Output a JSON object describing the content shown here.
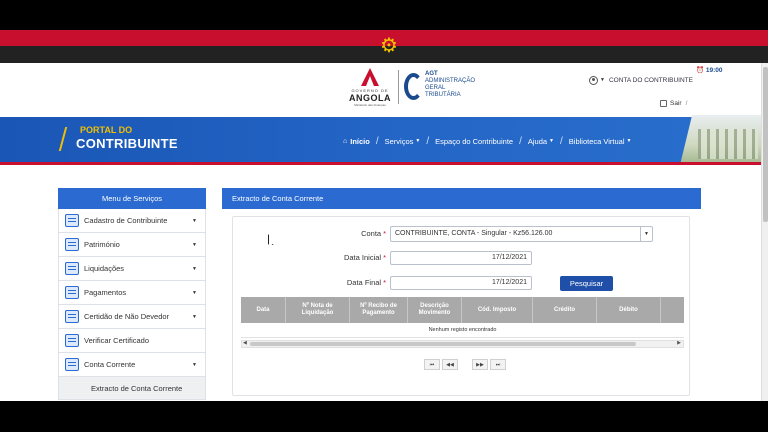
{
  "header": {
    "gov_logo": {
      "small": "GOVERNO DE",
      "big": "ANGOLA",
      "tiny": "Ministério das Finanças"
    },
    "agt_logo": {
      "abbr": "AGT",
      "line1": "ADMINISTRAÇÃO",
      "line2": "GERAL",
      "line3": "TRIBUTÁRIA"
    },
    "account_label": "CONTA DO CONTRIBUINTE",
    "time": "19:00",
    "logout_label": "Sair"
  },
  "banner": {
    "brand_line1": "PORTAL DO",
    "brand_line2": "CONTRIBUINTE",
    "nav": [
      {
        "label": "Início",
        "icon": "home-icon",
        "dropdown": false
      },
      {
        "label": "Serviços",
        "dropdown": true
      },
      {
        "label": "Espaço do Contribuinte",
        "dropdown": false
      },
      {
        "label": "Ajuda",
        "dropdown": true
      },
      {
        "label": "Biblioteca Virtual",
        "dropdown": true
      }
    ]
  },
  "sidebar": {
    "title": "Menu de Serviços",
    "items": [
      {
        "label": "Cadastro de Contribuinte",
        "icon": "registry-icon",
        "dropdown": true
      },
      {
        "label": "Património",
        "icon": "building-icon",
        "dropdown": true
      },
      {
        "label": "Liquidações",
        "icon": "document-icon",
        "dropdown": true
      },
      {
        "label": "Pagamentos",
        "icon": "payment-icon",
        "dropdown": true
      },
      {
        "label": "Certidão de Não Devedor",
        "icon": "certificate-icon",
        "dropdown": true
      },
      {
        "label": "Verificar Certificado",
        "icon": "verify-icon",
        "dropdown": false
      },
      {
        "label": "Conta Corrente",
        "icon": "ledger-icon",
        "dropdown": true
      }
    ],
    "subitem": "Extracto de Conta Corrente"
  },
  "main": {
    "title": "Extracto de Conta Corrente",
    "form": {
      "conta_label": "Conta",
      "conta_value": "CONTRIBUINTE, CONTA - Singular - Kz56.126.00",
      "data_inicial_label": "Data Inicial",
      "data_inicial_value": "17/12/2021",
      "data_final_label": "Data Final",
      "data_final_value": "17/12/2021",
      "required_mark": "*",
      "search_button": "Pesquisar"
    },
    "table": {
      "columns": [
        "Data",
        "Nº Nota de Liquidação",
        "Nº Recibo de Pagamento",
        "Descrição Movimento",
        "Cód. Imposto",
        "Crédito",
        "Débito"
      ],
      "empty_message": "Nenhum registo encontrado"
    },
    "pager": [
      "⏮",
      "◀◀",
      "▶▶",
      "⏭"
    ]
  },
  "colors": {
    "flag_red": "#c8102e",
    "flag_black": "#222222",
    "primary_blue": "#2a6ad1",
    "button_blue": "#1f4fa8",
    "brand_yellow": "#f0c000"
  }
}
